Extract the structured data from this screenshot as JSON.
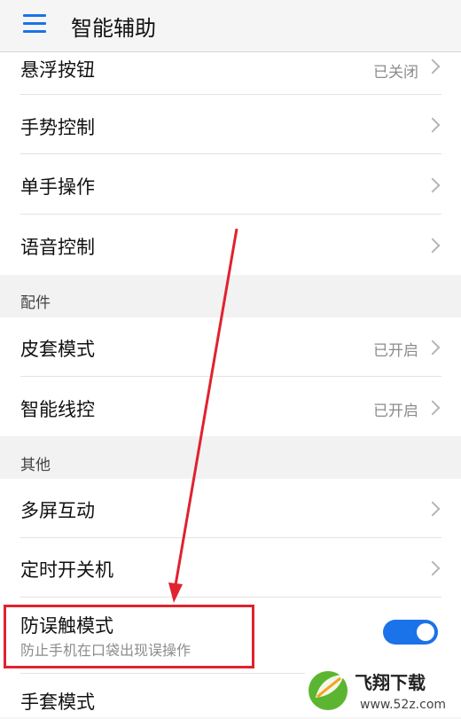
{
  "header": {
    "title": "智能辅助",
    "menu_icon": "menu-icon"
  },
  "rows": {
    "floating_button": {
      "label": "悬浮按钮",
      "value": "已关闭"
    },
    "gesture_control": {
      "label": "手势控制"
    },
    "one_hand": {
      "label": "单手操作"
    },
    "voice_control": {
      "label": "语音控制"
    },
    "cover_mode": {
      "label": "皮套模式",
      "value": "已开启"
    },
    "smart_wire": {
      "label": "智能线控",
      "value": "已开启"
    },
    "multi_screen": {
      "label": "多屏互动"
    },
    "scheduled_power": {
      "label": "定时开关机"
    },
    "accidental_touch": {
      "label": "防误触模式",
      "subtitle": "防止手机在口袋出现误操作",
      "toggle_on": true
    },
    "glove_mode": {
      "label": "手套模式"
    }
  },
  "sections": {
    "accessories": "配件",
    "other": "其他"
  },
  "watermark": {
    "brand": "飞翔下载",
    "url": "www.52z.com"
  },
  "colors": {
    "accent": "#1a73e8",
    "annotation": "#e0222f"
  }
}
